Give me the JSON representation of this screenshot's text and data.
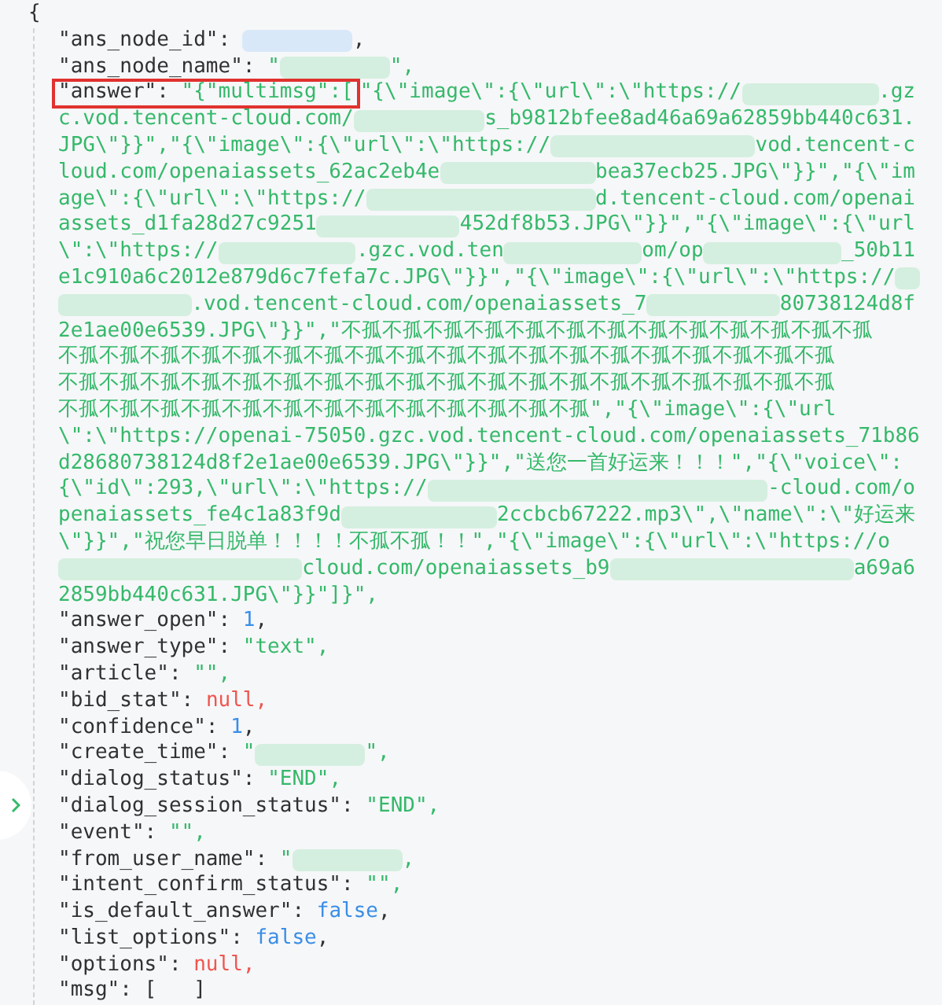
{
  "open_brace": "{",
  "lines": [
    {
      "wrapped": false,
      "segments": [
        {
          "kind": "key",
          "text": "\"ans_node_id\""
        },
        {
          "kind": "punct",
          "text": ": "
        },
        {
          "kind": "redacted",
          "color": "#d9e8f8"
        },
        {
          "kind": "punct",
          "text": ","
        }
      ]
    },
    {
      "wrapped": false,
      "segments": [
        {
          "kind": "key",
          "text": "\"ans_node_name\""
        },
        {
          "kind": "punct",
          "text": ": "
        },
        {
          "kind": "string",
          "text": "\""
        },
        {
          "kind": "redacted",
          "color": "#d4efdf"
        },
        {
          "kind": "string",
          "text": "\","
        }
      ]
    },
    {
      "wrapped": true,
      "segments": [
        {
          "kind": "key",
          "text": "\"answer\"",
          "boxed": true
        },
        {
          "kind": "punct",
          "text": ": ",
          "boxed": true
        },
        {
          "kind": "string",
          "text": "\"{\"multimsg\":[",
          "boxed": true
        },
        {
          "kind": "string",
          "text": "\"{\\\"image\\\":{\\\"url\\\":\\\"https://"
        },
        {
          "kind": "redacted",
          "color": "#d4efdf"
        },
        {
          "kind": "string",
          "text": ".gz"
        }
      ]
    },
    {
      "wrapped": true,
      "segments": [
        {
          "kind": "string",
          "text": "c.vod.tencent-cloud.com/"
        },
        {
          "kind": "redacted",
          "color": "#d4efdf"
        },
        {
          "kind": "string",
          "text": "s_b9812bfee8ad46a69a62859bb440c631."
        }
      ]
    },
    {
      "wrapped": true,
      "segments": [
        {
          "kind": "string",
          "text": "JPG\\\"}}\",\"{\\\"image\\\":{\\\"url\\\":\\\"https://"
        },
        {
          "kind": "redacted",
          "color": "#d4efdf"
        },
        {
          "kind": "string",
          "text": "vod.tencent-c"
        }
      ]
    },
    {
      "wrapped": true,
      "segments": [
        {
          "kind": "string",
          "text": "loud.com/openaiassets_62ac2eb4e"
        },
        {
          "kind": "redacted",
          "color": "#d4efdf"
        },
        {
          "kind": "string",
          "text": "bea37ecb25.JPG\\\"}}\",\"{\\\"im"
        }
      ]
    },
    {
      "wrapped": true,
      "segments": [
        {
          "kind": "string",
          "text": "age\\\":{\\\"url\\\":\\\"https://"
        },
        {
          "kind": "redacted",
          "color": "#d4efdf"
        },
        {
          "kind": "string",
          "text": "d.tencent-cloud.com/openai"
        }
      ]
    },
    {
      "wrapped": true,
      "segments": [
        {
          "kind": "string",
          "text": "assets_d1fa28d27c9251"
        },
        {
          "kind": "redacted",
          "color": "#d4efdf"
        },
        {
          "kind": "string",
          "text": "452df8b53.JPG\\\"}}\",\"{\\\"image\\\":{\\\"url"
        }
      ]
    },
    {
      "wrapped": true,
      "segments": [
        {
          "kind": "string",
          "text": "\\\":\\\"https://"
        },
        {
          "kind": "redacted",
          "color": "#d4efdf"
        },
        {
          "kind": "string",
          "text": ".gzc.vod.ten"
        },
        {
          "kind": "redacted",
          "color": "#d4efdf"
        },
        {
          "kind": "string",
          "text": "om/op"
        },
        {
          "kind": "redacted",
          "color": "#d4efdf"
        },
        {
          "kind": "string",
          "text": "_50b11"
        }
      ]
    },
    {
      "wrapped": true,
      "segments": [
        {
          "kind": "string",
          "text": "e1c910a6c2012e879d6c7fefa7c.JPG\\\"}}\",\"{\\\"image\\\":{\\\"url\\\":\\\"https://"
        },
        {
          "kind": "redacted",
          "color": "#d4efdf"
        }
      ]
    },
    {
      "wrapped": true,
      "segments": [
        {
          "kind": "redacted",
          "color": "#d4efdf"
        },
        {
          "kind": "string",
          "text": ".vod.tencent-cloud.com/openaiassets_7"
        },
        {
          "kind": "redacted",
          "color": "#d4efdf"
        },
        {
          "kind": "string",
          "text": "80738124d8f"
        }
      ]
    },
    {
      "wrapped": true,
      "segments": [
        {
          "kind": "string",
          "text": "2e1ae00e6539.JPG\\\"}}\",\"不孤不孤不孤不孤不孤不孤不孤不孤不孤不孤不孤不孤不孤"
        }
      ]
    },
    {
      "wrapped": true,
      "segments": [
        {
          "kind": "string",
          "text": "不孤不孤不孤不孤不孤不孤不孤不孤不孤不孤不孤不孤不孤不孤不孤不孤不孤不孤不孤"
        }
      ]
    },
    {
      "wrapped": true,
      "segments": [
        {
          "kind": "string",
          "text": "不孤不孤不孤不孤不孤不孤不孤不孤不孤不孤不孤不孤不孤不孤不孤不孤不孤不孤不孤"
        }
      ]
    },
    {
      "wrapped": true,
      "segments": [
        {
          "kind": "string",
          "text": "不孤不孤不孤不孤不孤不孤不孤不孤不孤不孤不孤不孤不孤\",\"{\\\"image\\\":{\\\"url"
        }
      ]
    },
    {
      "wrapped": true,
      "segments": [
        {
          "kind": "string",
          "text": "\\\":\\\"https://openai-75050.gzc.vod.tencent-cloud.com/openaiassets_71b86"
        }
      ]
    },
    {
      "wrapped": true,
      "segments": [
        {
          "kind": "string",
          "text": "d28680738124d8f2e1ae00e6539.JPG\\\"}}\",\"送您一首好运来！！！\",\"{\\\"voice\\\":"
        }
      ]
    },
    {
      "wrapped": true,
      "segments": [
        {
          "kind": "string",
          "text": "{\\\"id\\\":293,\\\"url\\\":\\\"https://"
        },
        {
          "kind": "redacted",
          "color": "#d4efdf"
        },
        {
          "kind": "string",
          "text": "-cloud.com/o"
        }
      ]
    },
    {
      "wrapped": true,
      "segments": [
        {
          "kind": "string",
          "text": "penaiassets_fe4c1a83f9d"
        },
        {
          "kind": "redacted",
          "color": "#d4efdf"
        },
        {
          "kind": "string",
          "text": "2ccbcb67222.mp3\\\",\\\"name\\\":\\\"好运来"
        }
      ]
    },
    {
      "wrapped": true,
      "segments": [
        {
          "kind": "string",
          "text": "\\\"}}\",\"祝您早日脱单！！！！不孤不孤！！\",\"{\\\"image\\\":{\\\"url\\\":\\\"https://o"
        }
      ]
    },
    {
      "wrapped": true,
      "segments": [
        {
          "kind": "redacted",
          "color": "#d4efdf"
        },
        {
          "kind": "string",
          "text": "cloud.com/openaiassets_b9"
        },
        {
          "kind": "redacted",
          "color": "#d4efdf"
        },
        {
          "kind": "string",
          "text": "a69a6"
        }
      ]
    },
    {
      "wrapped": false,
      "segments": [
        {
          "kind": "string",
          "text": "2859bb440c631.JPG\\\"}}\"]}\","
        }
      ]
    },
    {
      "wrapped": false,
      "segments": [
        {
          "kind": "key",
          "text": "\"answer_open\""
        },
        {
          "kind": "punct",
          "text": ": "
        },
        {
          "kind": "number",
          "text": "1"
        },
        {
          "kind": "punct",
          "text": ","
        }
      ]
    },
    {
      "wrapped": false,
      "segments": [
        {
          "kind": "key",
          "text": "\"answer_type\""
        },
        {
          "kind": "punct",
          "text": ": "
        },
        {
          "kind": "string",
          "text": "\"text\","
        }
      ]
    },
    {
      "wrapped": false,
      "segments": [
        {
          "kind": "key",
          "text": "\"article\""
        },
        {
          "kind": "punct",
          "text": ": "
        },
        {
          "kind": "string",
          "text": "\"\","
        }
      ]
    },
    {
      "wrapped": false,
      "segments": [
        {
          "kind": "key",
          "text": "\"bid_stat\""
        },
        {
          "kind": "punct",
          "text": ": "
        },
        {
          "kind": "null",
          "text": "null,"
        }
      ]
    },
    {
      "wrapped": false,
      "segments": [
        {
          "kind": "key",
          "text": "\"confidence\""
        },
        {
          "kind": "punct",
          "text": ": "
        },
        {
          "kind": "number",
          "text": "1"
        },
        {
          "kind": "punct",
          "text": ","
        }
      ]
    },
    {
      "wrapped": false,
      "segments": [
        {
          "kind": "key",
          "text": "\"create_time\""
        },
        {
          "kind": "punct",
          "text": ": "
        },
        {
          "kind": "string",
          "text": "\""
        },
        {
          "kind": "redacted",
          "color": "#d4efdf"
        },
        {
          "kind": "string",
          "text": "\","
        }
      ]
    },
    {
      "wrapped": false,
      "segments": [
        {
          "kind": "key",
          "text": "\"dialog_status\""
        },
        {
          "kind": "punct",
          "text": ": "
        },
        {
          "kind": "string",
          "text": "\"END\","
        }
      ]
    },
    {
      "wrapped": false,
      "segments": [
        {
          "kind": "key",
          "text": "\"dialog_session_status\""
        },
        {
          "kind": "punct",
          "text": ": "
        },
        {
          "kind": "string",
          "text": "\"END\","
        }
      ]
    },
    {
      "wrapped": false,
      "segments": [
        {
          "kind": "key",
          "text": "\"event\""
        },
        {
          "kind": "punct",
          "text": ": "
        },
        {
          "kind": "string",
          "text": "\"\","
        }
      ]
    },
    {
      "wrapped": false,
      "segments": [
        {
          "kind": "key",
          "text": "\"from_user_name\""
        },
        {
          "kind": "punct",
          "text": ": "
        },
        {
          "kind": "string",
          "text": "\""
        },
        {
          "kind": "redacted",
          "color": "#d4efdf"
        },
        {
          "kind": "string",
          "text": ","
        }
      ]
    },
    {
      "wrapped": false,
      "segments": [
        {
          "kind": "key",
          "text": "\"intent_confirm_status\""
        },
        {
          "kind": "punct",
          "text": ": "
        },
        {
          "kind": "string",
          "text": "\"\","
        }
      ]
    },
    {
      "wrapped": false,
      "segments": [
        {
          "kind": "key",
          "text": "\"is_default_answer\""
        },
        {
          "kind": "punct",
          "text": ": "
        },
        {
          "kind": "bool",
          "text": "false"
        },
        {
          "kind": "punct",
          "text": ","
        }
      ]
    },
    {
      "wrapped": false,
      "segments": [
        {
          "kind": "key",
          "text": "\"list_options\""
        },
        {
          "kind": "punct",
          "text": ": "
        },
        {
          "kind": "bool",
          "text": "false"
        },
        {
          "kind": "punct",
          "text": ","
        }
      ]
    },
    {
      "wrapped": false,
      "segments": [
        {
          "kind": "key",
          "text": "\"options\""
        },
        {
          "kind": "punct",
          "text": ": "
        },
        {
          "kind": "null",
          "text": "null,"
        }
      ]
    },
    {
      "wrapped": false,
      "segments": [
        {
          "kind": "key",
          "text": "\"msg\""
        },
        {
          "kind": "punct",
          "text": ": [   ]"
        }
      ]
    }
  ]
}
